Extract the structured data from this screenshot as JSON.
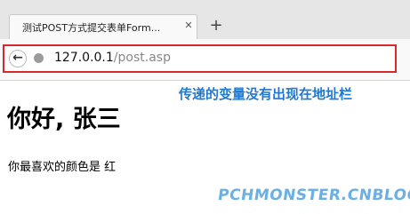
{
  "browser": {
    "tab_title": "测试POST方式提交表单Form...",
    "tab_close": "✕",
    "new_tab": "+",
    "back_icon_glyph": "←",
    "url_host": "127.0.0.1",
    "url_path": "/post.asp"
  },
  "annotation": "传递的变量没有出现在地址栏",
  "page": {
    "greeting": "你好, 张三",
    "color_line": "你最喜欢的颜色是 红"
  },
  "watermark": "PCHMONSTER.CNBLOGS.COM",
  "colors": {
    "highlight_border": "#d8282a",
    "annotation": "#1f78d2",
    "watermark": "#6ab0e6"
  }
}
